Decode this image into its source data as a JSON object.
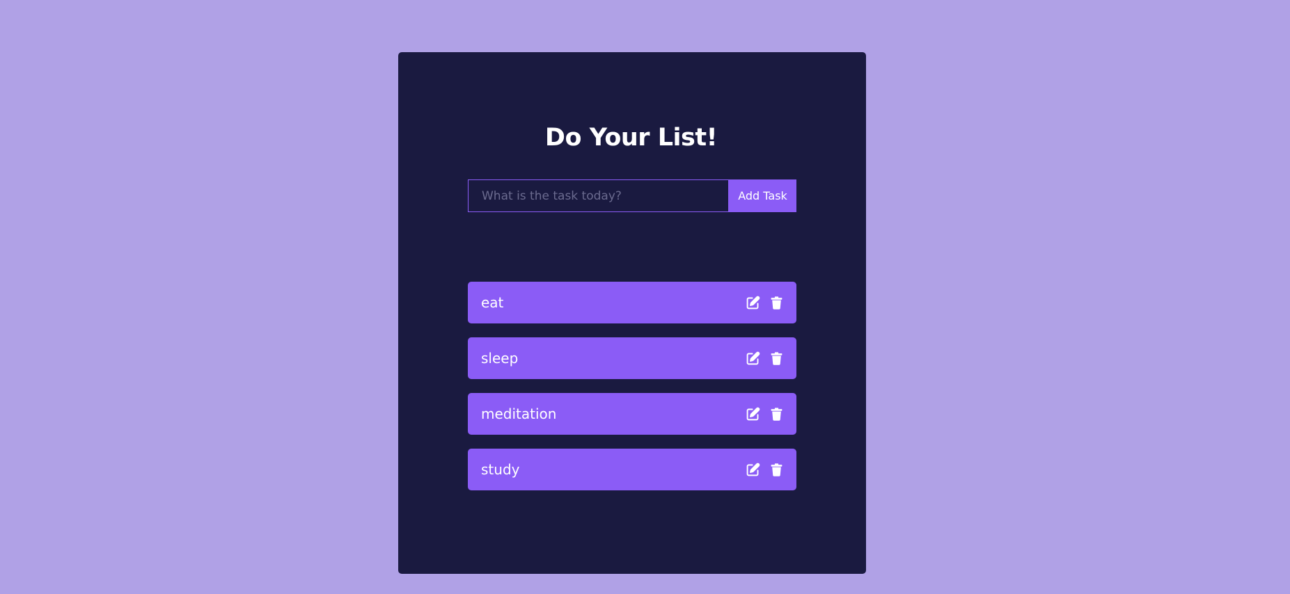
{
  "header": {
    "title": "Do Your List!"
  },
  "form": {
    "placeholder": "What is the task today?",
    "value": "",
    "add_label": "Add Task"
  },
  "tasks": [
    {
      "label": "eat"
    },
    {
      "label": "sleep"
    },
    {
      "label": "meditation"
    },
    {
      "label": "study"
    }
  ],
  "icons": {
    "edit": "edit-icon",
    "delete": "trash-icon"
  },
  "colors": {
    "background": "#b0a1e6",
    "card": "#1a1a40",
    "accent": "#8b5cf6",
    "text": "#ffffff"
  }
}
